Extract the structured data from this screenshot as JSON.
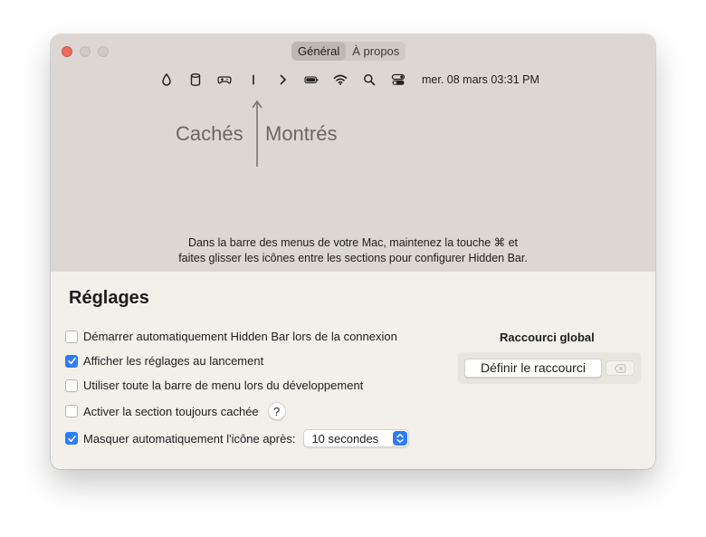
{
  "tabs": [
    {
      "label": "Général",
      "active": true
    },
    {
      "label": "À propos",
      "active": false
    }
  ],
  "menubar": {
    "icons": [
      "drop-icon",
      "cylinder-icon",
      "gamepad-icon",
      "separator-icon",
      "chevron-right-icon",
      "battery-icon",
      "wifi-icon",
      "search-icon",
      "control-center-icon"
    ],
    "clock": "mer. 08 mars 03:31 PM"
  },
  "sections": {
    "hidden_label": "Cachés",
    "shown_label": "Montrés"
  },
  "instructions": {
    "line1": "Dans la barre des menus de votre Mac, maintenez la touche ⌘ et",
    "line2": "faites glisser les icônes entre les sections pour configurer Hidden Bar."
  },
  "settings": {
    "title": "Réglages",
    "options": [
      {
        "label": "Démarrer automatiquement Hidden Bar lors de la connexion",
        "checked": false
      },
      {
        "label": "Afficher les réglages au lancement",
        "checked": true
      },
      {
        "label": "Utiliser toute la barre de menu lors du développement",
        "checked": false
      },
      {
        "label": "Activer la section toujours cachée",
        "checked": false
      },
      {
        "label": "Masquer automatiquement l'icône après:",
        "checked": true
      }
    ],
    "help_label": "?",
    "autohide_value": "10 secondes"
  },
  "shortcut": {
    "title": "Raccourci global",
    "button_label": "Définir le raccourci"
  },
  "colors": {
    "accent": "#2f7cf6",
    "close": "#ed6a5e",
    "top_bg": "#dcd7d3",
    "bottom_bg": "#f3f0ec"
  }
}
